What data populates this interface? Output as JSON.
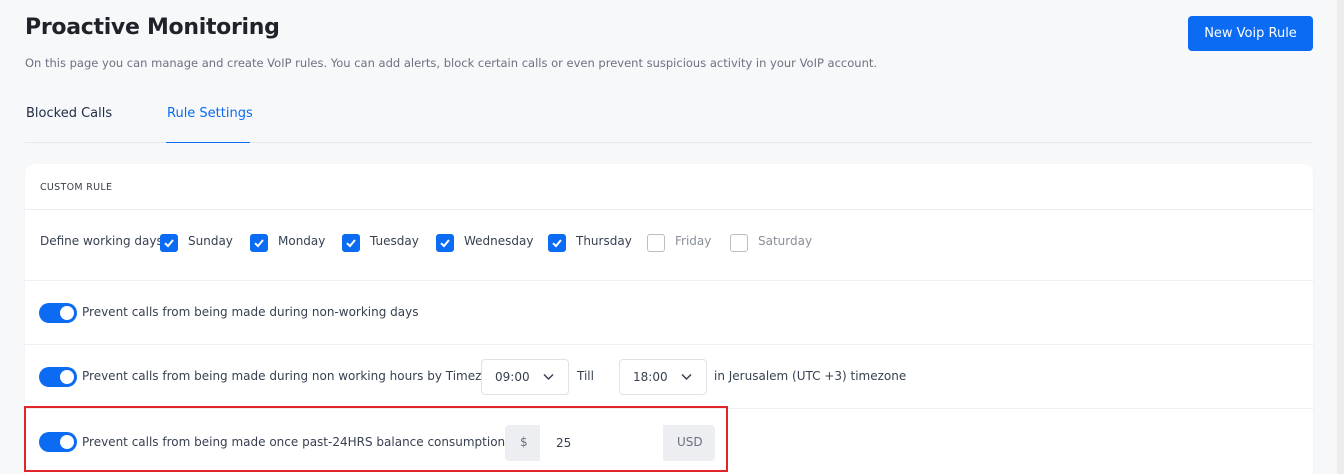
{
  "header": {
    "title": "Proactive Monitoring",
    "subtitle": "On this page you can manage and create VoIP rules. You can add alerts, block certain calls or even prevent suspicious activity in your VoIP account.",
    "new_rule_label": "New Voip Rule"
  },
  "tabs": [
    {
      "label": "Blocked Calls",
      "active": false
    },
    {
      "label": "Rule Settings",
      "active": true
    }
  ],
  "card": {
    "heading": "CUSTOM RULE",
    "working_days": {
      "label": "Define working days:",
      "days": [
        {
          "label": "Sunday",
          "checked": true
        },
        {
          "label": "Monday",
          "checked": true
        },
        {
          "label": "Tuesday",
          "checked": true
        },
        {
          "label": "Wednesday",
          "checked": true
        },
        {
          "label": "Thursday",
          "checked": true
        },
        {
          "label": "Friday",
          "checked": false
        },
        {
          "label": "Saturday",
          "checked": false
        }
      ]
    },
    "rule_nonworking_days": {
      "label": "Prevent calls from being made during non-working days",
      "enabled": true
    },
    "rule_hours": {
      "label": "Prevent calls from being made during non working hours by Timezone UTC",
      "from": "09:00",
      "till_label": "Till",
      "to": "18:00",
      "timezone_label": "in Jerusalem (UTC +3) timezone",
      "enabled": true
    },
    "rule_balance": {
      "label": "Prevent calls from being made once past-24HRS balance consumption is above:",
      "currency_symbol": "$",
      "amount": "25",
      "currency": "USD",
      "enabled": true
    }
  },
  "colors": {
    "accent": "#0b6bf2",
    "highlight": "#e0252b"
  }
}
